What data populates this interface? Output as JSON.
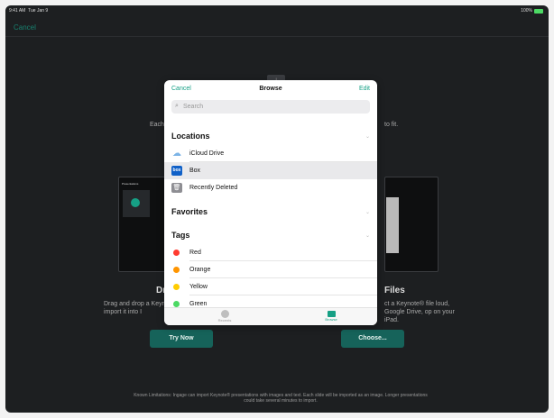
{
  "status": {
    "time": "9:41 AM",
    "date": "Tue Jan 9",
    "battery": "100%"
  },
  "background": {
    "cancel": "Cancel",
    "desc_left": "Each s",
    "desc_right": "to fit.",
    "heading_left": "Dra",
    "heading_right": "Files",
    "body_left": "Drag and drop a Keyno import it into I",
    "body_right": "ct a Keynote® file loud, Google Drive, op on your iPad.",
    "try_now": "Try Now",
    "choose": "Choose...",
    "device_label": "Presentations",
    "footnote": "Known Limitations: Ingage can import Keynote® presentations with images and text. Each slide will be imported as an image. Longer presentations could take several minutes to import."
  },
  "modal": {
    "cancel": "Cancel",
    "title": "Browse",
    "edit": "Edit",
    "search_placeholder": "Search",
    "sections": {
      "locations": "Locations",
      "favorites": "Favorites",
      "tags": "Tags"
    },
    "locations": [
      {
        "label": "iCloud Drive",
        "icon": "cloud-icon"
      },
      {
        "label": "Box",
        "icon": "box-icon",
        "selected": true
      },
      {
        "label": "Recently Deleted",
        "icon": "trash-icon"
      }
    ],
    "tags": [
      {
        "label": "Red",
        "color": "#ff3b30"
      },
      {
        "label": "Orange",
        "color": "#ff9500"
      },
      {
        "label": "Yellow",
        "color": "#ffcc00"
      },
      {
        "label": "Green",
        "color": "#4cd964"
      }
    ],
    "tabs": {
      "recents": "Recents",
      "browse": "Browse"
    }
  }
}
